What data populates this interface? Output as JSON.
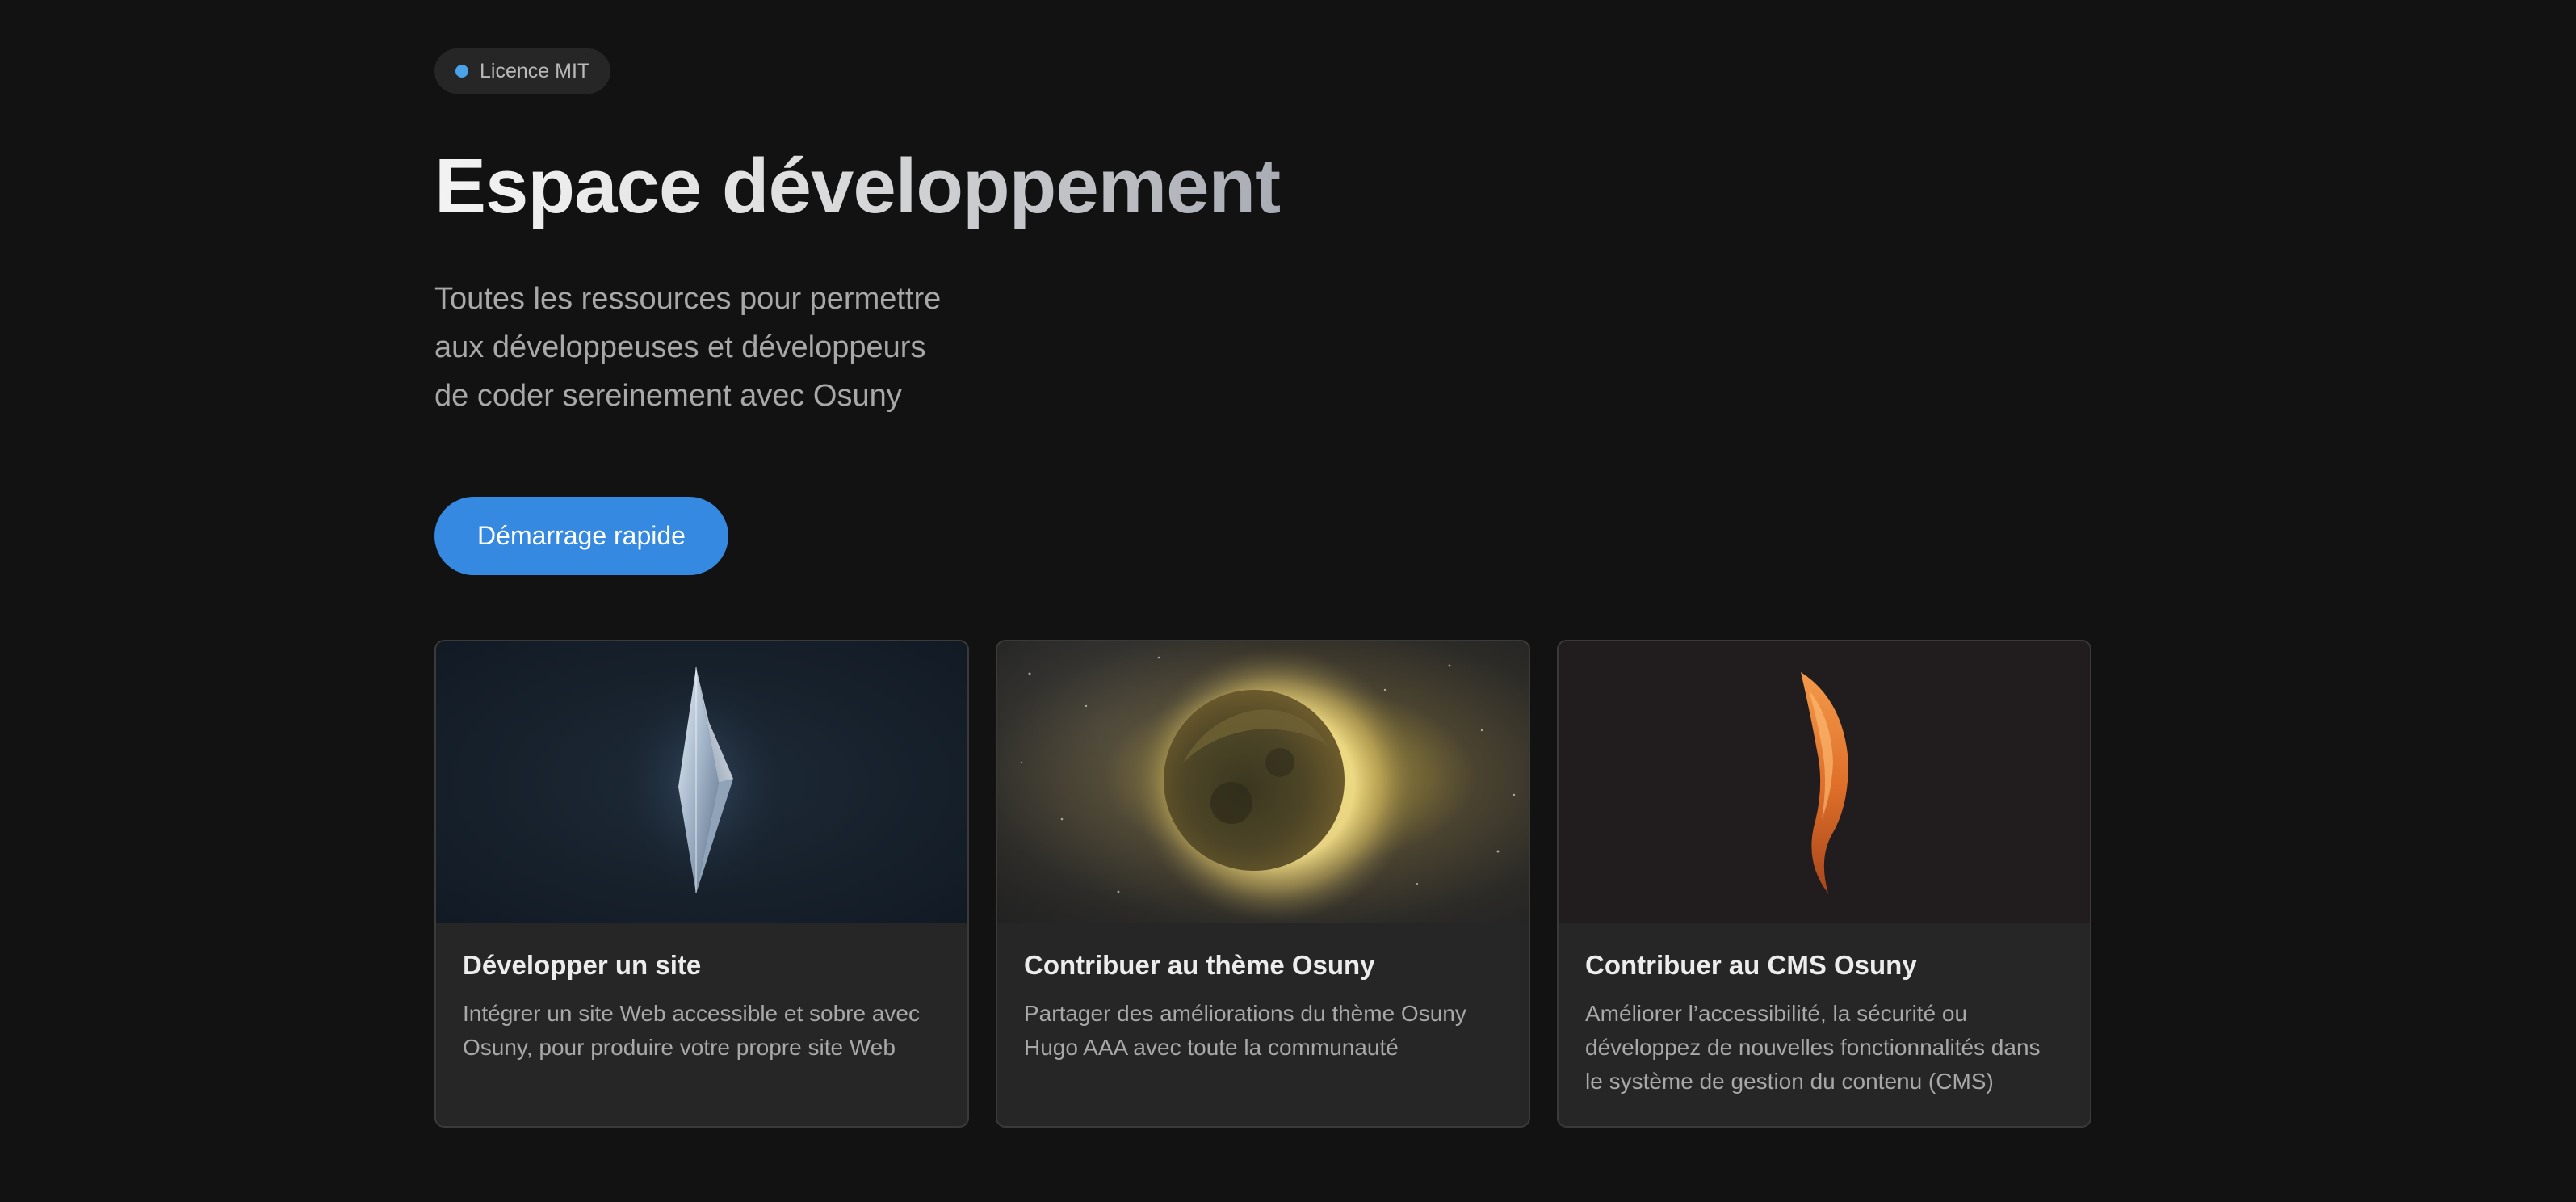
{
  "badge": {
    "label": "Licence MIT",
    "dot_color": "#4aa3e8"
  },
  "header": {
    "title": "Espace développement",
    "subtitle_lines": [
      "Toutes les ressources pour permettre",
      "aux développeuses et développeurs",
      "de coder sereinement avec Osuny"
    ]
  },
  "cta": {
    "label": "Démarrage rapide",
    "color": "#3589e0"
  },
  "cards": [
    {
      "image": "crystal-image",
      "title": "Développer un site",
      "description_lines": [
        "Intégrer un site Web accessible et sobre avec",
        "Osuny, pour produire votre propre site Web"
      ]
    },
    {
      "image": "planet-image",
      "title": "Contribuer au thème Osuny",
      "description_lines": [
        "Partager des améliorations du thème Osuny",
        "Hugo AAA avec toute la communauté"
      ]
    },
    {
      "image": "flame-image",
      "title": "Contribuer au CMS Osuny",
      "description_lines": [
        "Améliorer l’accessibilité, la sécurité ou",
        "développez de nouvelles fonctionnalités dans",
        "le système de gestion du contenu (CMS)"
      ]
    }
  ],
  "colors": {
    "background": "#121212",
    "card_background": "#262626",
    "text_muted": "#a8a8a8"
  }
}
